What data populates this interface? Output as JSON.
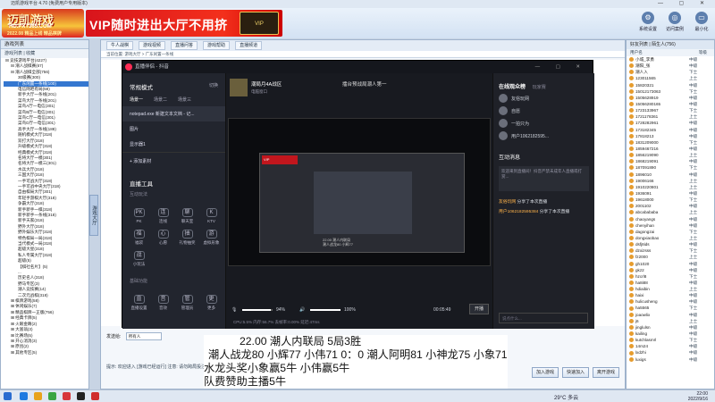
{
  "outer": {
    "title": "迈凯游戏平台 4.70 (免费用户专用版本)",
    "logo_line1": "迈凯游戏",
    "logo_line2": "HD.PXT365.COM",
    "logo_line3": "2022.08 精品上线 精品棋牌",
    "banner_text": "VIP随时进出大厅不用挤",
    "banner_badge": "VIP",
    "top_buttons": [
      {
        "label": "系统设置",
        "icon": "settings-icon"
      },
      {
        "label": "访问案例",
        "icon": "globe-icon"
      },
      {
        "label": "最小化",
        "icon": "minimize-icon"
      }
    ]
  },
  "left": {
    "header": "游戏列表",
    "tabs": "游戏列表 | 收藏",
    "tree": [
      {
        "d": 0,
        "t": "⊟ 竞技游戏平台(4227)"
      },
      {
        "d": 1,
        "t": "⊟ 潮人战棋赛(67)"
      },
      {
        "d": 1,
        "t": "⊟ 潮人战棋全部(756)"
      },
      {
        "d": 2,
        "t": "30级赛(300)"
      },
      {
        "d": 2,
        "t": "广东闲置一条线(100)",
        "sel": true
      },
      {
        "d": 2,
        "t": "电信网吧有局(58)"
      },
      {
        "d": 2,
        "t": "新手大厅一条线(201)"
      },
      {
        "d": 2,
        "t": "菜鸟大厅一条线(201)"
      },
      {
        "d": 2,
        "t": "菜鸟A厅一电信(301)"
      },
      {
        "d": 2,
        "t": "菜鸟B厅一电信(301)"
      },
      {
        "d": 2,
        "t": "菜鸟C厅一电信(301)"
      },
      {
        "d": 2,
        "t": "菜鸟D厅一电信(301)"
      },
      {
        "d": 2,
        "t": "高手大厅一条线(188)"
      },
      {
        "d": 2,
        "t": "随机模式大厅(318)"
      },
      {
        "d": 2,
        "t": "双打大厅(318)"
      },
      {
        "d": 2,
        "t": "升级模式大厅(318)"
      },
      {
        "d": 2,
        "t": "经典模式大厅(318)"
      },
      {
        "d": 2,
        "t": "名将大厅一模(301)"
      },
      {
        "d": 2,
        "t": "名将大厅一模三(301)"
      },
      {
        "d": 2,
        "t": "水兵大厅(318)"
      },
      {
        "d": 2,
        "t": "三国大厅(318)"
      },
      {
        "d": 2,
        "t": "一手可战大厅(318)"
      },
      {
        "d": 2,
        "t": "一手可战中央大厅(318)"
      },
      {
        "d": 2,
        "t": "自由棋局大厅(301)"
      },
      {
        "d": 2,
        "t": "年轻手游棋大厅(318)"
      },
      {
        "d": 2,
        "t": "争霸大厅(318)"
      },
      {
        "d": 2,
        "t": "新手新手一棋(318)"
      },
      {
        "d": 2,
        "t": "新手新手一条线(318)"
      },
      {
        "d": 2,
        "t": "新手天家(318)"
      },
      {
        "d": 2,
        "t": "野外大厅(318)"
      },
      {
        "d": 2,
        "t": "野外娱乐大厅(318)"
      },
      {
        "d": 2,
        "t": "特色棋局一局(318)"
      },
      {
        "d": 2,
        "t": "当代模式一局(318)"
      },
      {
        "d": 2,
        "t": "超级大星(318)"
      },
      {
        "d": 2,
        "t": "私人专属大厅(318)"
      },
      {
        "d": 2,
        "t": "超级(5)"
      },
      {
        "d": 2,
        "t": "【棋社名片】(5)"
      },
      {
        "d": 2,
        "t": "..."
      },
      {
        "d": 2,
        "t": "历史名人(318)"
      },
      {
        "d": 2,
        "t": "野马专区(3)"
      },
      {
        "d": 2,
        "t": "潮人竞技赛(14)"
      },
      {
        "d": 2,
        "t": "二次元战棋(318)"
      },
      {
        "d": 1,
        "t": "⊞ 棋牌游戏(58)"
      },
      {
        "d": 1,
        "t": "⊞ 休闲娱乐(7)"
      },
      {
        "d": 1,
        "t": "⊞ 精品棋牌一正版(756)"
      },
      {
        "d": 1,
        "t": "⊞ 经典卡牌(5)"
      },
      {
        "d": 1,
        "t": "⊞ 火眼金睛(2)"
      },
      {
        "d": 1,
        "t": "⊞ 大富翁(3)"
      },
      {
        "d": 1,
        "t": "⊞ 比赛场(5)"
      },
      {
        "d": 1,
        "t": "⊞ 开心消消(3)"
      },
      {
        "d": 1,
        "t": "⊞ 原创(2)"
      },
      {
        "d": 1,
        "t": "⊞ 其他专区(5)"
      }
    ],
    "side_tab": "游戏大厅"
  },
  "center": {
    "tabs": [
      "牛人战棋",
      "游戏视频",
      "直播问答",
      "游戏帮助",
      "直播频道"
    ],
    "path": "当前位置: 游戏大厅 > 广东闲置一条线",
    "chat_label": "发送给:",
    "chat_target": "所有人",
    "tip": "提示: 欢迎进入 [游戏已经运行] 注意: 请勿跨局投注",
    "buttons": [
      "加入游戏",
      "快速加入",
      "离开游戏"
    ]
  },
  "right": {
    "header": "好友列表 | 陌生人(756)",
    "col1": "用户名",
    "col2": "等级",
    "users": [
      {
        "n": "小城_李勇",
        "r": "中级"
      },
      {
        "n": "潮阳_张",
        "r": "中级"
      },
      {
        "n": "潮人入",
        "r": "下士"
      },
      {
        "n": "123011565",
        "r": "上士"
      },
      {
        "n": "15820321",
        "r": "中级"
      },
      {
        "n": "15012173063",
        "r": "下士"
      },
      {
        "n": "1505628919",
        "r": "中级"
      },
      {
        "n": "15056280165",
        "r": "中级"
      },
      {
        "n": "1723133967",
        "r": "下士"
      },
      {
        "n": "1721178361",
        "r": "上士"
      },
      {
        "n": "1728282961",
        "r": "中级"
      },
      {
        "n": "173182345",
        "r": "中级"
      },
      {
        "n": "17818213",
        "r": "中级"
      },
      {
        "n": "1831209000",
        "r": "下士"
      },
      {
        "n": "1859467216",
        "r": "中级"
      },
      {
        "n": "1856219090",
        "r": "上士"
      },
      {
        "n": "1868219091",
        "r": "中级"
      },
      {
        "n": "187091890",
        "r": "下士"
      },
      {
        "n": "1896010",
        "r": "中级"
      },
      {
        "n": "19006166",
        "r": "上士"
      },
      {
        "n": "1910220801",
        "r": "上士"
      },
      {
        "n": "1936091",
        "r": "中级"
      },
      {
        "n": "19618000",
        "r": "下士"
      },
      {
        "n": "2001102",
        "r": "中级"
      },
      {
        "n": "abcabababa",
        "r": "上士"
      },
      {
        "n": "chaoyangs",
        "r": "中级"
      },
      {
        "n": "chenyihan",
        "r": "中级"
      },
      {
        "n": "dagongzai",
        "r": "下士"
      },
      {
        "n": "dongxiaobao",
        "r": "上士"
      },
      {
        "n": "dsfj8ids",
        "r": "中级"
      },
      {
        "n": "dzxizsss",
        "r": "下士"
      },
      {
        "n": "fz2000",
        "r": "上士"
      },
      {
        "n": "gh1020",
        "r": "中级"
      },
      {
        "n": "gkz2",
        "r": "中级"
      },
      {
        "n": "hzcrl8",
        "r": "下士"
      },
      {
        "n": "ha8i88",
        "r": "中级"
      },
      {
        "n": "hdiaibin",
        "r": "上士"
      },
      {
        "n": "haixi",
        "r": "中级"
      },
      {
        "n": "hulicusheng",
        "r": "中级"
      },
      {
        "n": "ha5565",
        "r": "下士"
      },
      {
        "n": "joaowlix",
        "r": "中级"
      },
      {
        "n": "j6",
        "r": "上士"
      },
      {
        "n": "jinglulsn",
        "r": "中级"
      },
      {
        "n": "kailing",
        "r": "中级"
      },
      {
        "n": "kutchlasmrl",
        "r": "下士"
      },
      {
        "n": "14m24",
        "r": "中级"
      },
      {
        "n": "lxdzhi",
        "r": "中级"
      },
      {
        "n": "luxigs",
        "r": "中级"
      }
    ]
  },
  "stream": {
    "title": "直播伴侣 - 抖音",
    "panel_head": "常规模式",
    "panel_action": "切换",
    "scene_tabs": [
      "场景一",
      "场景二",
      "场景三"
    ],
    "scenes": [
      "notepad.exe 新建文本文档 - 记...",
      "图片",
      "显示器1"
    ],
    "add_source": "+ 添加素材",
    "tools_title": "直播工具",
    "tools_sub1": "互动玩法",
    "tools_sub2": "基础功能",
    "tools": [
      {
        "i": "PK",
        "l": "PK"
      },
      {
        "i": "连",
        "l": "连线"
      },
      {
        "i": "聊",
        "l": "聊天室"
      },
      {
        "i": "K",
        "l": "KTV"
      },
      {
        "i": "福",
        "l": "福袋"
      },
      {
        "i": "心",
        "l": "心愿"
      },
      {
        "i": "抽",
        "l": "礼物抽奖"
      },
      {
        "i": "游",
        "l": "虚拟形象"
      },
      {
        "i": "战",
        "l": "小玩法"
      },
      {
        "i": "直",
        "l": "直播设置"
      },
      {
        "i": "音",
        "l": "音效"
      },
      {
        "i": "管",
        "l": "管理员"
      },
      {
        "i": "更",
        "l": "更多"
      }
    ],
    "mid_name": "潮局月4A战区",
    "mid_sub": "电脑窗口",
    "live_text": "擂台预战局潮人第一",
    "vol1": "94%",
    "vol2": "100%",
    "time": "00:05:49",
    "live_btn": "开播",
    "status": "CPU:5.5%  内存:56.7%  丢帧率:0.00%  延迟:47ms",
    "right_head": "在线观众榜",
    "right_head2": "玩家赛",
    "viewers": [
      "友俗玩网",
      "自愿",
      "一拍只为",
      "用户1062182595..."
    ],
    "ia_title": "互动消息",
    "ia_box": "欢迎来到直播间！抖音严禁未成年人直播或打赏...",
    "messages": [
      {
        "n": "友俗玩网",
        "t": "分享了本次直播"
      },
      {
        "n": "用户1062182595384",
        "t": "分享了本次直播"
      }
    ],
    "send_placeholder": "说点什么..."
  },
  "overlay": {
    "line1": "22.00   潮人内联局        5局3胜",
    "line2": "潮人战龙80  小辉77  小伟71  0：0     潮人阿明81  小神龙75  小象71",
    "line3": "水龙头奖小象赢5牛    小伟赢5牛",
    "line4": "队费赞助主播5牛"
  },
  "taskbar": {
    "weather": "29°C 多云",
    "time": "22:00",
    "date": "2022/9/16"
  }
}
